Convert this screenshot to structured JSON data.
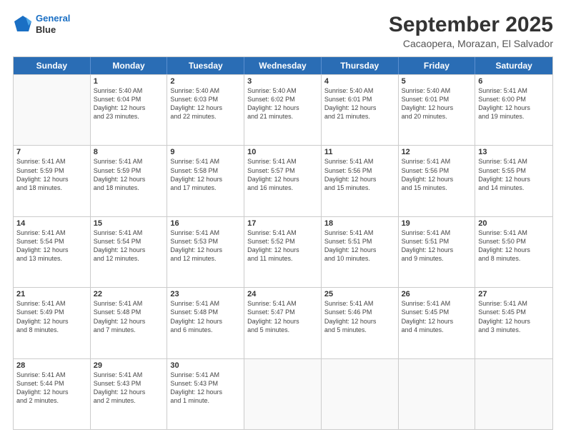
{
  "header": {
    "logo_line1": "General",
    "logo_line2": "Blue",
    "title": "September 2025",
    "subtitle": "Cacaopera, Morazan, El Salvador"
  },
  "days_of_week": [
    "Sunday",
    "Monday",
    "Tuesday",
    "Wednesday",
    "Thursday",
    "Friday",
    "Saturday"
  ],
  "weeks": [
    [
      {
        "day": "",
        "text": ""
      },
      {
        "day": "1",
        "text": "Sunrise: 5:40 AM\nSunset: 6:04 PM\nDaylight: 12 hours\nand 23 minutes."
      },
      {
        "day": "2",
        "text": "Sunrise: 5:40 AM\nSunset: 6:03 PM\nDaylight: 12 hours\nand 22 minutes."
      },
      {
        "day": "3",
        "text": "Sunrise: 5:40 AM\nSunset: 6:02 PM\nDaylight: 12 hours\nand 21 minutes."
      },
      {
        "day": "4",
        "text": "Sunrise: 5:40 AM\nSunset: 6:01 PM\nDaylight: 12 hours\nand 21 minutes."
      },
      {
        "day": "5",
        "text": "Sunrise: 5:40 AM\nSunset: 6:01 PM\nDaylight: 12 hours\nand 20 minutes."
      },
      {
        "day": "6",
        "text": "Sunrise: 5:41 AM\nSunset: 6:00 PM\nDaylight: 12 hours\nand 19 minutes."
      }
    ],
    [
      {
        "day": "7",
        "text": "Sunrise: 5:41 AM\nSunset: 5:59 PM\nDaylight: 12 hours\nand 18 minutes."
      },
      {
        "day": "8",
        "text": "Sunrise: 5:41 AM\nSunset: 5:59 PM\nDaylight: 12 hours\nand 18 minutes."
      },
      {
        "day": "9",
        "text": "Sunrise: 5:41 AM\nSunset: 5:58 PM\nDaylight: 12 hours\nand 17 minutes."
      },
      {
        "day": "10",
        "text": "Sunrise: 5:41 AM\nSunset: 5:57 PM\nDaylight: 12 hours\nand 16 minutes."
      },
      {
        "day": "11",
        "text": "Sunrise: 5:41 AM\nSunset: 5:56 PM\nDaylight: 12 hours\nand 15 minutes."
      },
      {
        "day": "12",
        "text": "Sunrise: 5:41 AM\nSunset: 5:56 PM\nDaylight: 12 hours\nand 15 minutes."
      },
      {
        "day": "13",
        "text": "Sunrise: 5:41 AM\nSunset: 5:55 PM\nDaylight: 12 hours\nand 14 minutes."
      }
    ],
    [
      {
        "day": "14",
        "text": "Sunrise: 5:41 AM\nSunset: 5:54 PM\nDaylight: 12 hours\nand 13 minutes."
      },
      {
        "day": "15",
        "text": "Sunrise: 5:41 AM\nSunset: 5:54 PM\nDaylight: 12 hours\nand 12 minutes."
      },
      {
        "day": "16",
        "text": "Sunrise: 5:41 AM\nSunset: 5:53 PM\nDaylight: 12 hours\nand 12 minutes."
      },
      {
        "day": "17",
        "text": "Sunrise: 5:41 AM\nSunset: 5:52 PM\nDaylight: 12 hours\nand 11 minutes."
      },
      {
        "day": "18",
        "text": "Sunrise: 5:41 AM\nSunset: 5:51 PM\nDaylight: 12 hours\nand 10 minutes."
      },
      {
        "day": "19",
        "text": "Sunrise: 5:41 AM\nSunset: 5:51 PM\nDaylight: 12 hours\nand 9 minutes."
      },
      {
        "day": "20",
        "text": "Sunrise: 5:41 AM\nSunset: 5:50 PM\nDaylight: 12 hours\nand 8 minutes."
      }
    ],
    [
      {
        "day": "21",
        "text": "Sunrise: 5:41 AM\nSunset: 5:49 PM\nDaylight: 12 hours\nand 8 minutes."
      },
      {
        "day": "22",
        "text": "Sunrise: 5:41 AM\nSunset: 5:48 PM\nDaylight: 12 hours\nand 7 minutes."
      },
      {
        "day": "23",
        "text": "Sunrise: 5:41 AM\nSunset: 5:48 PM\nDaylight: 12 hours\nand 6 minutes."
      },
      {
        "day": "24",
        "text": "Sunrise: 5:41 AM\nSunset: 5:47 PM\nDaylight: 12 hours\nand 5 minutes."
      },
      {
        "day": "25",
        "text": "Sunrise: 5:41 AM\nSunset: 5:46 PM\nDaylight: 12 hours\nand 5 minutes."
      },
      {
        "day": "26",
        "text": "Sunrise: 5:41 AM\nSunset: 5:45 PM\nDaylight: 12 hours\nand 4 minutes."
      },
      {
        "day": "27",
        "text": "Sunrise: 5:41 AM\nSunset: 5:45 PM\nDaylight: 12 hours\nand 3 minutes."
      }
    ],
    [
      {
        "day": "28",
        "text": "Sunrise: 5:41 AM\nSunset: 5:44 PM\nDaylight: 12 hours\nand 2 minutes."
      },
      {
        "day": "29",
        "text": "Sunrise: 5:41 AM\nSunset: 5:43 PM\nDaylight: 12 hours\nand 2 minutes."
      },
      {
        "day": "30",
        "text": "Sunrise: 5:41 AM\nSunset: 5:43 PM\nDaylight: 12 hours\nand 1 minute."
      },
      {
        "day": "",
        "text": ""
      },
      {
        "day": "",
        "text": ""
      },
      {
        "day": "",
        "text": ""
      },
      {
        "day": "",
        "text": ""
      }
    ]
  ]
}
